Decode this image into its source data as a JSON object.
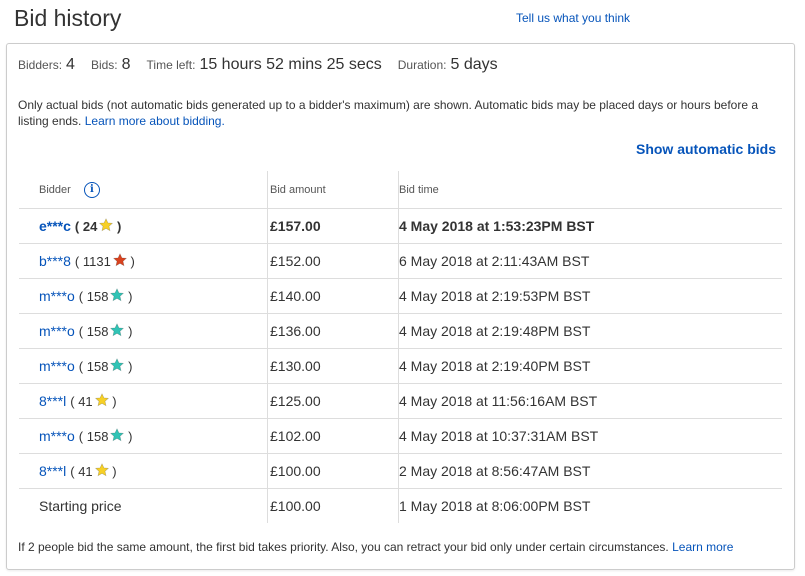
{
  "header": {
    "title": "Bid history",
    "feedback_link": "Tell us what you think"
  },
  "summary": {
    "bidders_label": "Bidders:",
    "bidders_value": "4",
    "bids_label": "Bids:",
    "bids_value": "8",
    "time_left_label": "Time left:",
    "time_left_value": "15 hours 52 mins 25 secs",
    "duration_label": "Duration:",
    "duration_value": "5 days"
  },
  "notice": {
    "text": "Only actual bids (not automatic bids generated up to a bidder's maximum) are shown. Automatic bids may be placed days or hours before a listing ends.",
    "link": "Learn more about bidding."
  },
  "show_automatic_bids": "Show automatic bids",
  "table": {
    "headers": {
      "bidder": "Bidder",
      "amount": "Bid amount",
      "time": "Bid time"
    },
    "rows": [
      {
        "bidder": "e***c",
        "feedback": "24",
        "star": "yellow-star-icon",
        "amount": "£157.00",
        "time": "4 May 2018 at 1:53:23PM BST"
      },
      {
        "bidder": "b***8",
        "feedback": "1131",
        "star": "red-star-icon",
        "amount": "£152.00",
        "time": "6 May 2018 at 2:11:43AM BST"
      },
      {
        "bidder": "m***o",
        "feedback": "158",
        "star": "teal-star-icon",
        "amount": "£140.00",
        "time": "4 May 2018 at 2:19:53PM BST"
      },
      {
        "bidder": "m***o",
        "feedback": "158",
        "star": "teal-star-icon",
        "amount": "£136.00",
        "time": "4 May 2018 at 2:19:48PM BST"
      },
      {
        "bidder": "m***o",
        "feedback": "158",
        "star": "teal-star-icon",
        "amount": "£130.00",
        "time": "4 May 2018 at 2:19:40PM BST"
      },
      {
        "bidder": "8***l",
        "feedback": "41",
        "star": "yellow-star-icon",
        "amount": "£125.00",
        "time": "4 May 2018 at 11:56:16AM BST"
      },
      {
        "bidder": "m***o",
        "feedback": "158",
        "star": "teal-star-icon",
        "amount": "£102.00",
        "time": "4 May 2018 at 10:37:31AM BST"
      },
      {
        "bidder": "8***l",
        "feedback": "41",
        "star": "yellow-star-icon",
        "amount": "£100.00",
        "time": "2 May 2018 at 8:56:47AM BST"
      }
    ],
    "starting": {
      "label": "Starting price",
      "amount": "£100.00",
      "time": "1 May 2018 at 8:06:00PM BST"
    }
  },
  "footer": {
    "text": "If 2 people bid the same amount, the first bid takes priority. Also, you can retract your bid only under certain circumstances.",
    "link": "Learn more"
  },
  "colors": {
    "link": "#0654ba",
    "yellow_star": "#f7d026",
    "red_star": "#d9431f",
    "teal_star": "#31c3b5"
  }
}
